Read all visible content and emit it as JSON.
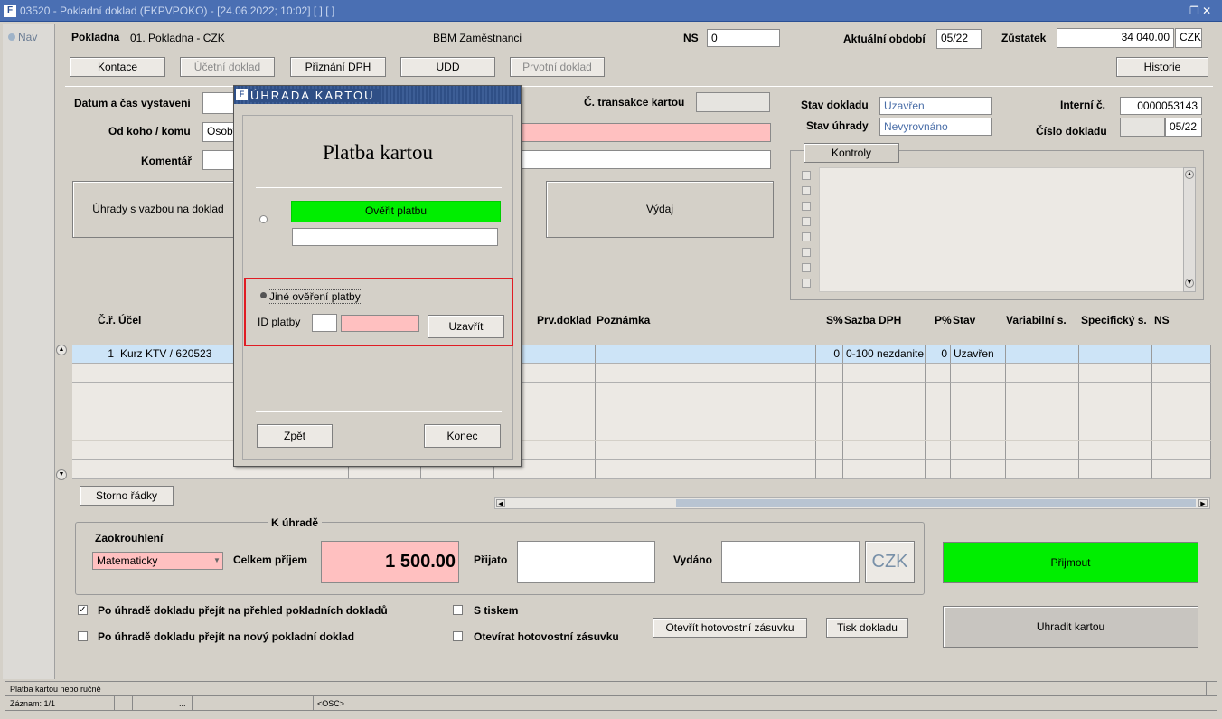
{
  "window": {
    "title": "03520 - Pokladní doklad (EKPVPOKO) - [24.06.2022; 10:02] [ ] [ ]",
    "controls": "❐ ✕"
  },
  "nav": {
    "label": "Nav"
  },
  "header": {
    "pokladna_label": "Pokladna",
    "pokladna_value": "01. Pokladna - CZK",
    "employee": "BBM Zaměstnanci",
    "ns_label": "NS",
    "ns_value": "0",
    "obdobi_label": "Aktuální období",
    "obdobi_value": "05/22",
    "zustatek_label": "Zůstatek",
    "zustatek_value": "34 040.00",
    "currency": "CZK"
  },
  "toolbar": {
    "kontace": "Kontace",
    "ucetni": "Účetní doklad",
    "dph": "Přiznání DPH",
    "udd": "UDD",
    "prvotni": "Prvotní doklad",
    "historie": "Historie"
  },
  "form": {
    "datum_label": "Datum a čas vystavení",
    "odkoho_label": "Od koho / komu",
    "odkoho_value": "Osoby",
    "komentar_label": "Komentář",
    "transakce_label": "Č. transakce kartou",
    "stav_dokladu_label": "Stav dokladu",
    "stav_dokladu_value": "Uzavřen",
    "stav_uhrady_label": "Stav úhrady",
    "stav_uhrady_value": "Nevyrovnáno",
    "interni_label": "Interní č.",
    "interni_value": "0000053143",
    "cislo_label": "Číslo dokladu",
    "cislo_value": "05/22",
    "uhrady_btn": "Úhrady s vazbou na doklad",
    "vydaj_btn": "Výdaj",
    "kontroly_tab": "Kontroly"
  },
  "grid": {
    "headers": {
      "cr": "Č.ř.",
      "ucel": "Účel",
      "prv": "Prv.doklad",
      "poznamka": "Poznámka",
      "s": "S%",
      "sazba": "Sazba DPH",
      "p": "P%",
      "stav": "Stav",
      "vs": "Variabilní s.",
      "ss": "Specifický s.",
      "ns": "NS"
    },
    "row1": {
      "cr": "1",
      "ucel": "Kurz KTV / 620523",
      "s": "0",
      "sazba": "0-100 nezdanite",
      "p": "0",
      "stav": "Uzavřen"
    }
  },
  "storno": "Storno řádky",
  "payment": {
    "k_uhrade": "K úhradě",
    "zaokrouhleni_label": "Zaokrouhlení",
    "zaokrouhleni_value": "Matematicky",
    "celkem_label": "Celkem příjem",
    "celkem_value": "1 500.00",
    "prijato_label": "Přijato",
    "vydano_label": "Vydáno",
    "currency": "CZK",
    "prijmout": "Přijmout",
    "uhradit": "Uhradit kartou",
    "otevrit": "Otevřít hotovostní zásuvku",
    "tisk": "Tisk dokladu"
  },
  "options": {
    "opt1": "Po úhradě dokladu přejít na přehled pokladních dokladů",
    "opt2": "Po úhradě dokladu přejít na nový pokladní doklad",
    "opt3": "S tiskem",
    "opt4": "Otevírat hotovostní zásuvku"
  },
  "dialog": {
    "title": "ÚHRADA KARTOU",
    "heading": "Platba kartou",
    "overit": "Ověřit platbu",
    "jine": "Jiné ověření platby",
    "id_label": "ID platby",
    "uzavrit": "Uzavřít",
    "zpet": "Zpět",
    "konec": "Konec"
  },
  "status": {
    "message": "Platba kartou nebo ručně",
    "zaznam": "Záznam: 1/1",
    "dots": "...",
    "osc": "<OSC>"
  },
  "colors": {
    "title_bar": "#4a6fb3",
    "green": "#00ee00",
    "pink": "#ffc0c0",
    "highlight": "#e01c24",
    "selected_row": "#cde4f7"
  }
}
